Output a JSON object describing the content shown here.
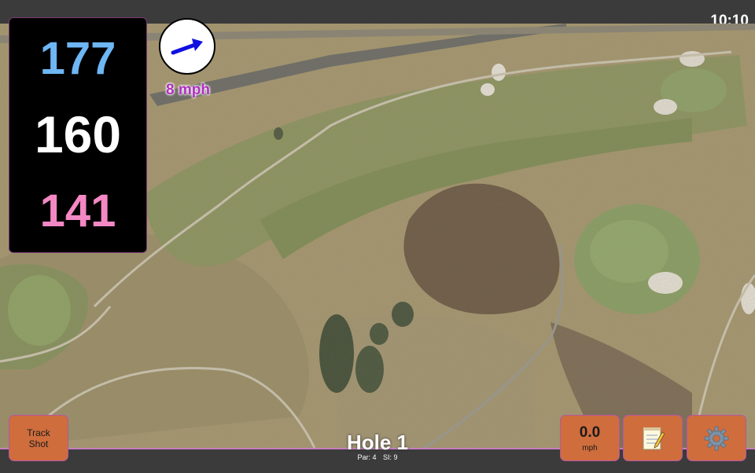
{
  "status_bar": {
    "time": "10:10"
  },
  "distances": {
    "back": "177",
    "middle": "160",
    "front": "141"
  },
  "wind": {
    "speed": "8 mph",
    "direction_icon": "arrow-icon"
  },
  "hole": {
    "title": "Hole 1",
    "par": "Par: 4",
    "stroke_index": "SI: 9"
  },
  "buttons": {
    "track_shot_line1": "Track",
    "track_shot_line2": "Shot",
    "speed_value": "0.0",
    "speed_unit": "mph",
    "notes_icon": "notepad-icon",
    "settings_icon": "gear-icon"
  },
  "colors": {
    "back_distance": "#6eb6f4",
    "middle_distance": "#ffffff",
    "front_distance": "#f488c4",
    "button": "#cf6d3d",
    "wind_text": "#b12fbe"
  }
}
